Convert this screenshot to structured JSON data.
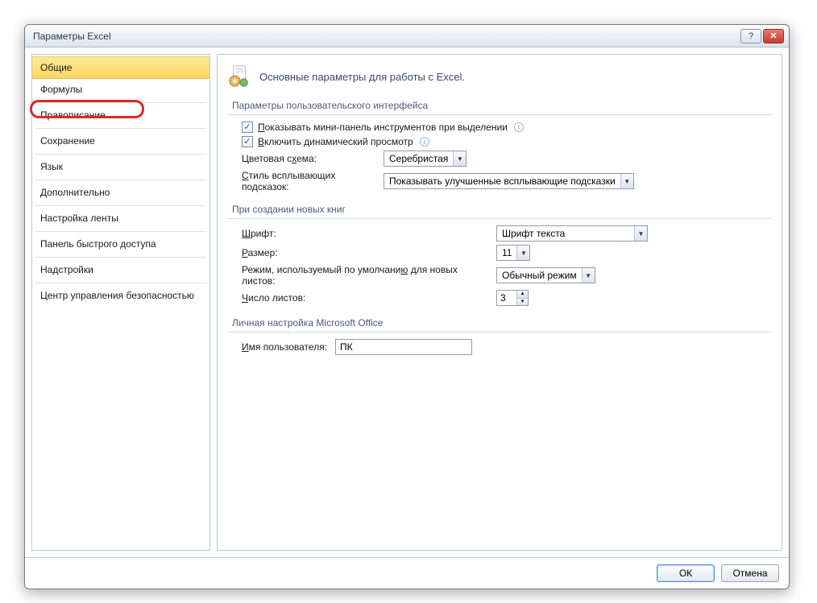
{
  "window": {
    "title": "Параметры Excel"
  },
  "sidebar": {
    "items": [
      "Общие",
      "Формулы",
      "Правописание",
      "Сохранение",
      "Язык",
      "Дополнительно",
      "Настройка ленты",
      "Панель быстрого доступа",
      "Надстройки",
      "Центр управления безопасностью"
    ]
  },
  "main": {
    "heading": "Основные параметры для работы с Excel.",
    "ui_section": {
      "title": "Параметры пользовательского интерфейса",
      "mini_toolbar_prefix": "П",
      "mini_toolbar_rest": "оказывать мини-панель инструментов при выделении",
      "live_preview_prefix": "В",
      "live_preview_rest": "ключить динамический просмотр",
      "color_scheme_label_pre": "Цветовая с",
      "color_scheme_label_u": "х",
      "color_scheme_label_post": "ема:",
      "color_scheme_value": "Серебристая",
      "tooltip_style_label_pre": "С",
      "tooltip_style_label_rest": "тиль всплывающих подсказок:",
      "tooltip_style_value": "Показывать улучшенные всплывающие подсказки"
    },
    "new_wb": {
      "title": "При создании новых книг",
      "font_label_u": "Ш",
      "font_label_rest": "рифт:",
      "font_value": "Шрифт текста",
      "size_label_u": "Р",
      "size_label_rest": "азмер:",
      "size_value": "11",
      "view_label_pre": "Режим, используемый по умолчани",
      "view_label_u": "ю",
      "view_label_post": " для новых листов:",
      "view_value": "Обычный режим",
      "sheets_label_u": "Ч",
      "sheets_label_rest": "исло листов:",
      "sheets_value": "3"
    },
    "personal": {
      "title": "Личная настройка Microsoft Office",
      "username_label_u": "И",
      "username_label_rest": "мя пользователя:",
      "username_value": "ПК"
    }
  },
  "footer": {
    "ok": "ОК",
    "cancel": "Отмена"
  }
}
